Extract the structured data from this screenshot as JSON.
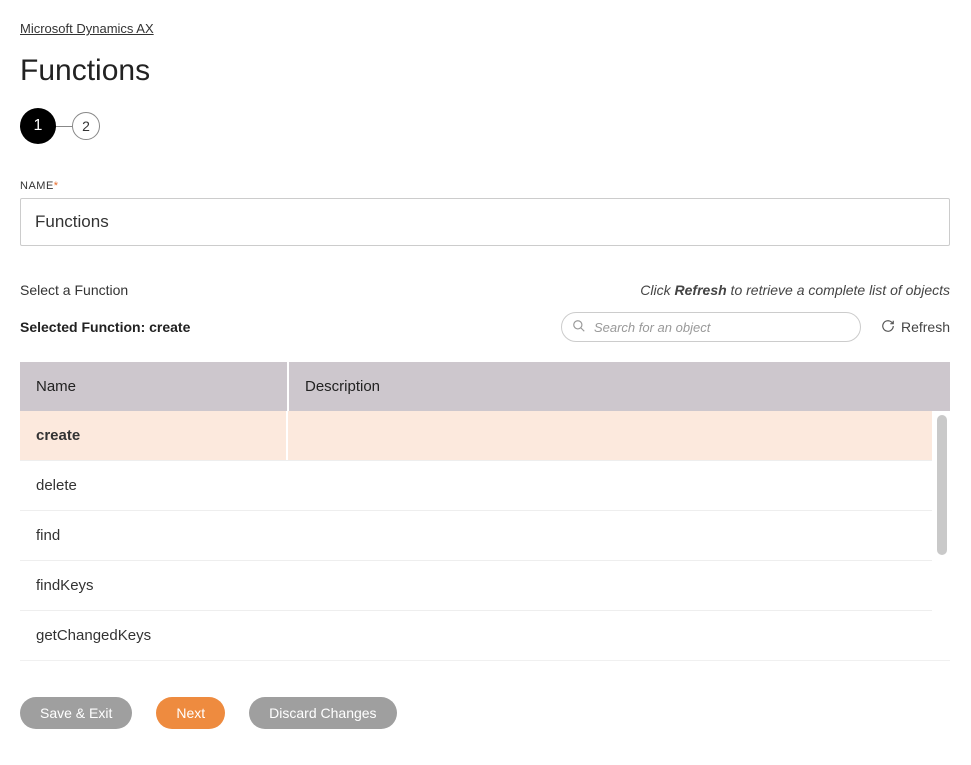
{
  "breadcrumb": "Microsoft Dynamics AX",
  "page_title": "Functions",
  "stepper": {
    "step1": "1",
    "step2": "2"
  },
  "name_field": {
    "label": "NAME",
    "required": "*",
    "value": "Functions"
  },
  "section": {
    "select_label": "Select a Function",
    "hint_prefix": "Click ",
    "hint_bold": "Refresh",
    "hint_suffix": " to retrieve a complete list of objects",
    "selected_prefix": "Selected Function: ",
    "selected_value": "create"
  },
  "search": {
    "placeholder": "Search for an object"
  },
  "refresh_label": "Refresh",
  "table": {
    "columns": {
      "name": "Name",
      "description": "Description"
    },
    "rows": [
      {
        "name": "create",
        "description": "",
        "selected": true
      },
      {
        "name": "delete",
        "description": "",
        "selected": false
      },
      {
        "name": "find",
        "description": "",
        "selected": false
      },
      {
        "name": "findKeys",
        "description": "",
        "selected": false
      },
      {
        "name": "getChangedKeys",
        "description": "",
        "selected": false
      }
    ]
  },
  "buttons": {
    "save_exit": "Save & Exit",
    "next": "Next",
    "discard": "Discard Changes"
  }
}
